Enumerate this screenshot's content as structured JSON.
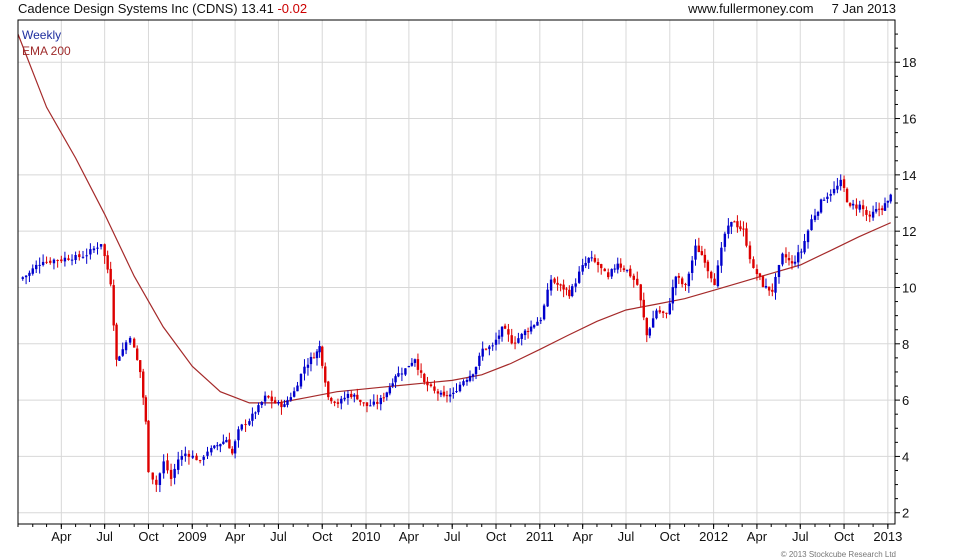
{
  "header": {
    "title": "Cadence Design Systems Inc (CDNS)",
    "last_price": "13.41",
    "change": "-0.02",
    "website": "www.fullermoney.com",
    "date": "7 Jan 2013"
  },
  "legend": {
    "weekly": "Weekly",
    "ema": "EMA 200"
  },
  "copyright": "© 2013 Stockcube Research Ltd",
  "colors": {
    "up": "#0000cc",
    "down": "#dd0000",
    "ema": "#a52a2a",
    "grid": "#d8d8d8",
    "axis": "#000000"
  },
  "chart_data": {
    "type": "line",
    "grid": true,
    "legend_position": "top-left",
    "ylim": [
      1.6,
      19.5
    ],
    "y_ticks": [
      2,
      4,
      6,
      8,
      10,
      12,
      14,
      16,
      18
    ],
    "x_ticks": [
      {
        "label": "Apr",
        "date": "2008-04-01"
      },
      {
        "label": "Jul",
        "date": "2008-07-01"
      },
      {
        "label": "Oct",
        "date": "2008-10-01"
      },
      {
        "label": "2009",
        "date": "2009-01-01"
      },
      {
        "label": "Apr",
        "date": "2009-04-01"
      },
      {
        "label": "Jul",
        "date": "2009-07-01"
      },
      {
        "label": "Oct",
        "date": "2009-10-01"
      },
      {
        "label": "2010",
        "date": "2010-01-01"
      },
      {
        "label": "Apr",
        "date": "2010-04-01"
      },
      {
        "label": "Jul",
        "date": "2010-07-01"
      },
      {
        "label": "Oct",
        "date": "2010-10-01"
      },
      {
        "label": "2011",
        "date": "2011-01-01"
      },
      {
        "label": "Apr",
        "date": "2011-04-01"
      },
      {
        "label": "Jul",
        "date": "2011-07-01"
      },
      {
        "label": "Oct",
        "date": "2011-10-01"
      },
      {
        "label": "2012",
        "date": "2012-01-01"
      },
      {
        "label": "Apr",
        "date": "2012-04-01"
      },
      {
        "label": "Jul",
        "date": "2012-07-01"
      },
      {
        "label": "Oct",
        "date": "2012-10-01"
      },
      {
        "label": "2013",
        "date": "2013-01-01"
      }
    ],
    "series": [
      {
        "name": "Weekly",
        "type": "candlestick",
        "x": [
          "2008-01-11",
          "2008-02-01",
          "2008-03-01",
          "2008-04-01",
          "2008-05-01",
          "2008-06-01",
          "2008-07-01",
          "2008-07-20",
          "2008-08-01",
          "2008-08-15",
          "2008-09-01",
          "2008-09-20",
          "2008-10-01",
          "2008-10-10",
          "2008-10-25",
          "2008-11-10",
          "2008-11-25",
          "2008-12-10",
          "2008-12-25",
          "2009-01-10",
          "2009-01-25",
          "2009-02-10",
          "2009-03-01",
          "2009-03-20",
          "2009-04-01",
          "2009-04-15",
          "2009-05-01",
          "2009-05-20",
          "2009-06-10",
          "2009-07-01",
          "2009-07-20",
          "2009-08-10",
          "2009-09-01",
          "2009-09-20",
          "2009-10-01",
          "2009-10-20",
          "2009-11-10",
          "2009-12-01",
          "2009-12-20",
          "2010-01-10",
          "2010-02-01",
          "2010-02-20",
          "2010-03-10",
          "2010-04-01",
          "2010-04-20",
          "2010-05-10",
          "2010-06-01",
          "2010-06-20",
          "2010-07-10",
          "2010-08-01",
          "2010-08-20",
          "2010-09-10",
          "2010-10-01",
          "2010-10-20",
          "2010-11-10",
          "2010-12-01",
          "2010-12-20",
          "2011-01-10",
          "2011-02-01",
          "2011-02-20",
          "2011-03-10",
          "2011-04-01",
          "2011-04-20",
          "2011-05-10",
          "2011-06-01",
          "2011-06-20",
          "2011-07-10",
          "2011-08-01",
          "2011-08-20",
          "2011-09-10",
          "2011-10-01",
          "2011-10-20",
          "2011-11-10",
          "2011-12-01",
          "2011-12-20",
          "2012-01-10",
          "2012-02-01",
          "2012-02-20",
          "2012-03-10",
          "2012-04-01",
          "2012-04-20",
          "2012-05-10",
          "2012-06-01",
          "2012-06-20",
          "2012-07-10",
          "2012-08-01",
          "2012-08-20",
          "2012-09-10",
          "2012-10-01",
          "2012-10-20",
          "2012-11-10",
          "2012-12-01",
          "2012-12-20",
          "2013-01-07"
        ],
        "values": [
          10.5,
          11.0,
          11.0,
          11.1,
          11.2,
          11.6,
          10.2,
          7.4,
          7.8,
          8.3,
          7.0,
          5.2,
          3.5,
          3.0,
          3.8,
          3.2,
          3.9,
          4.1,
          4.0,
          3.8,
          4.2,
          4.4,
          4.6,
          4.1,
          4.9,
          5.2,
          5.6,
          6.1,
          5.9,
          5.8,
          6.3,
          7.2,
          7.6,
          7.9,
          6.1,
          5.9,
          6.2,
          6.1,
          5.8,
          5.9,
          6.3,
          6.9,
          7.1,
          7.5,
          6.6,
          6.3,
          6.1,
          6.2,
          6.7,
          7.0,
          7.8,
          7.9,
          8.5,
          8.1,
          8.3,
          8.6,
          8.9,
          10.3,
          10.0,
          9.8,
          10.5,
          11.0,
          10.8,
          10.3,
          10.9,
          10.6,
          10.1,
          8.3,
          9.2,
          9.0,
          10.4,
          10.0,
          11.4,
          11.0,
          10.2,
          11.9,
          12.4,
          12.0,
          10.6,
          10.1,
          9.9,
          11.1,
          10.8,
          11.3,
          12.4,
          13.0,
          13.4,
          13.7,
          12.8,
          12.9,
          12.4,
          12.8,
          13.0,
          13.4
        ]
      },
      {
        "name": "EMA 200",
        "type": "line",
        "x": [
          "2008-01-01",
          "2008-03-01",
          "2008-05-01",
          "2008-07-01",
          "2008-09-01",
          "2008-11-01",
          "2009-01-01",
          "2009-03-01",
          "2009-05-01",
          "2009-07-01",
          "2009-09-01",
          "2009-11-01",
          "2010-01-01",
          "2010-03-01",
          "2010-05-01",
          "2010-07-01",
          "2010-09-01",
          "2010-11-01",
          "2011-01-01",
          "2011-03-01",
          "2011-05-01",
          "2011-07-01",
          "2011-09-01",
          "2011-11-01",
          "2012-01-01",
          "2012-03-01",
          "2012-05-01",
          "2012-07-01",
          "2012-09-01",
          "2012-11-01",
          "2013-01-07"
        ],
        "values": [
          19.0,
          16.4,
          14.6,
          12.6,
          10.4,
          8.6,
          7.2,
          6.3,
          5.9,
          5.9,
          6.1,
          6.3,
          6.4,
          6.5,
          6.6,
          6.7,
          6.9,
          7.3,
          7.8,
          8.3,
          8.8,
          9.2,
          9.4,
          9.6,
          9.9,
          10.2,
          10.5,
          10.8,
          11.3,
          11.8,
          12.3
        ]
      }
    ]
  }
}
